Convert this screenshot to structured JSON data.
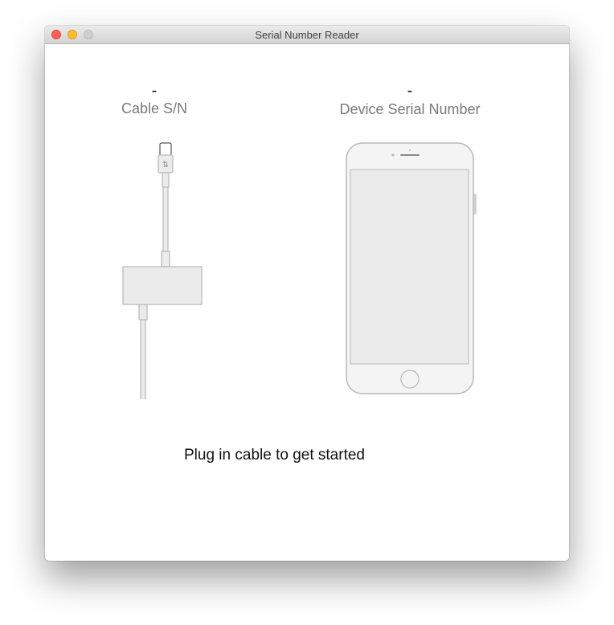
{
  "window": {
    "title": "Serial Number Reader",
    "controls": [
      "close-icon",
      "minimize-icon",
      "zoom-icon"
    ]
  },
  "cable": {
    "value": "-",
    "label": "Cable S/N",
    "icon": "usb-c-adapter-cable-icon"
  },
  "device": {
    "value": "-",
    "label": "Device Serial Number",
    "icon": "iphone-icon"
  },
  "status": "Plug in cable to get started"
}
